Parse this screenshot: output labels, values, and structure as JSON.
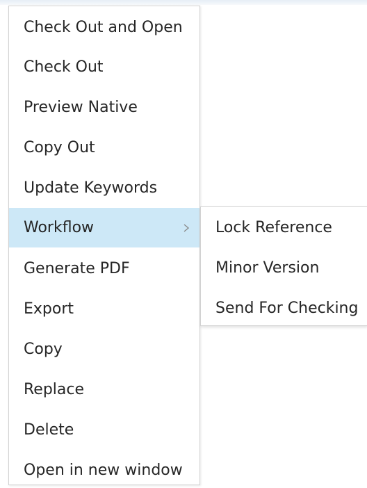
{
  "context_menu": {
    "items": [
      {
        "label": "Check Out and Open"
      },
      {
        "label": "Check Out"
      },
      {
        "label": "Preview Native"
      },
      {
        "label": "Copy Out"
      },
      {
        "label": "Update Keywords"
      },
      {
        "label": "Workflow",
        "has_submenu": true,
        "highlighted": true
      },
      {
        "label": "Generate PDF"
      },
      {
        "label": "Export"
      },
      {
        "label": "Copy"
      },
      {
        "label": "Replace"
      },
      {
        "label": "Delete"
      },
      {
        "label": "Open in new window"
      }
    ],
    "highlight_color": "#cde8f7"
  },
  "workflow_submenu": {
    "items": [
      {
        "label": "Lock Reference"
      },
      {
        "label": "Minor Version"
      },
      {
        "label": "Send For Checking"
      }
    ]
  },
  "icons": {
    "submenu_arrow": "chevron-right-icon"
  }
}
